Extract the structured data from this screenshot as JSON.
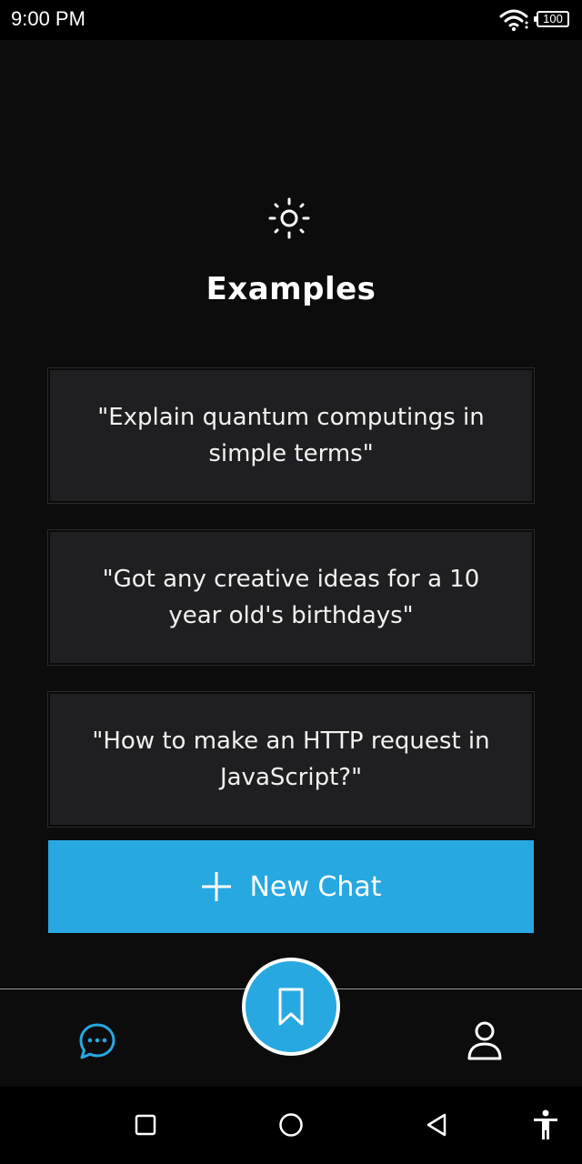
{
  "status_bar": {
    "time": "9:00 PM",
    "battery": "100",
    "icons": [
      "wifi-icon",
      "battery-icon"
    ]
  },
  "header": {
    "icon": "sun-icon",
    "title": "Examples"
  },
  "examples": [
    "\"Explain quantum computings in simple terms\"",
    "\"Got any creative ideas for a 10 year old's birthdays\"",
    "\"How to make an HTTP request in JavaScript?\""
  ],
  "new_chat": {
    "icon": "plus-icon",
    "label": "New Chat"
  },
  "bottom_nav": {
    "items": [
      "chat-bubble-icon",
      "bookmark-icon",
      "user-icon"
    ],
    "active": "chat-bubble-icon"
  },
  "system_nav": {
    "items": [
      "recents-icon",
      "home-icon",
      "back-icon",
      "accessibility-icon"
    ]
  },
  "colors": {
    "background": "#0c0c0c",
    "card": "#1f1f21",
    "accent": "#27a8e1",
    "text": "#ffffff"
  }
}
